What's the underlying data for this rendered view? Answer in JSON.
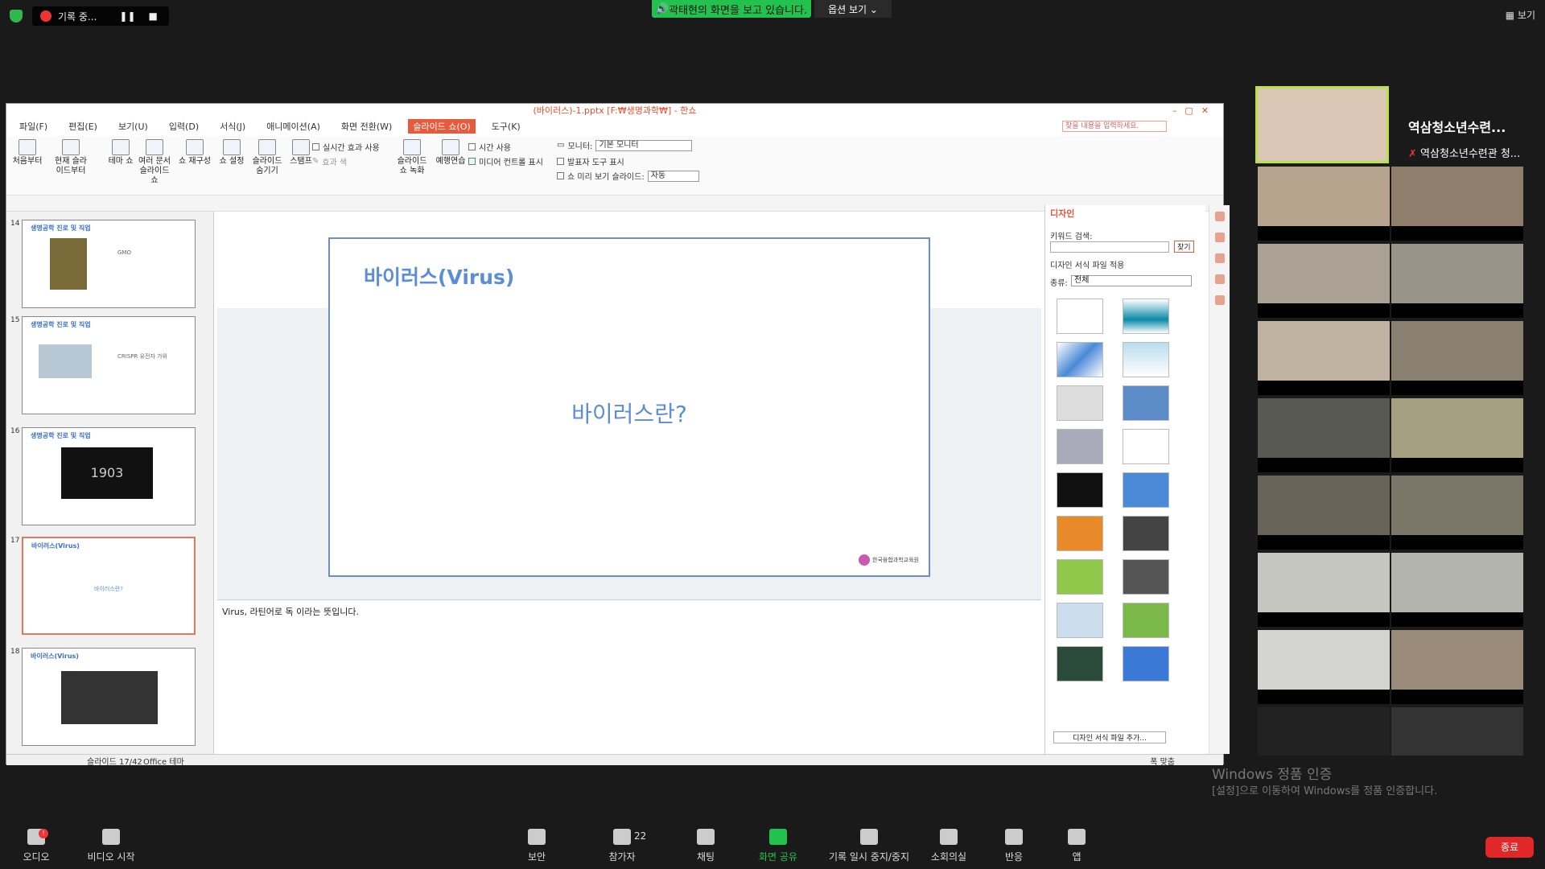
{
  "zoom_top": {
    "recording_label": "기록 중...",
    "viewing_banner": "곽태현의 화면을 보고 있습니다.",
    "view_options": "옵션 보기 ⌄",
    "view_mode": "보기"
  },
  "window": {
    "title": "(바이러스)-1.pptx [F:₩생명과학₩] - 한쇼",
    "menus": [
      "파일(F)",
      "편집(E)",
      "보기(U)",
      "입력(D)",
      "서식(J)",
      "애니메이션(A)",
      "화면 전환(W)",
      "슬라이드 쇼(O)",
      "도구(K)"
    ],
    "menu_search_placeholder": "찾을 내용을 입력하세요.",
    "ribbon": {
      "buttons": [
        "처음부터",
        "현재 슬라이드부터",
        "테마 쇼",
        "여러 문서 슬라이드 쇼",
        "쇼 재구성",
        "쇼 설정",
        "슬라이드 숨기기",
        "스탬프",
        "슬라이드 쇼 녹화",
        "예행연습"
      ],
      "opt_realtime_effect": "실시간 효과 사용",
      "opt_effect_color": "효과 색",
      "opt_use_timing": "시간 사용",
      "opt_media_controls": "미디어 컨트롤 표시",
      "monitor_label": "모니터:",
      "monitor_value": "기본 모니터",
      "opt_presenter_tools": "발표자 도구 표시",
      "preview_label": "쇼 미리 보기 슬라이드:",
      "preview_value": "자동"
    }
  },
  "slides": [
    {
      "num": "14",
      "header": "생명공학 진로 및 직업",
      "body": "GMO"
    },
    {
      "num": "15",
      "header": "생명공학 진로 및 직업",
      "body": "CRISPR 유전자 가위"
    },
    {
      "num": "16",
      "header": "생명공학 진로 및 직업",
      "body": "1903"
    },
    {
      "num": "17",
      "header": "바이러스(Virus)",
      "body": "바이러스란?"
    },
    {
      "num": "18",
      "header": "바이러스(Virus)",
      "body": ""
    }
  ],
  "current_slide": {
    "title": "바이러스(Virus)",
    "body": "바이러스란?",
    "logo_text": "한국융합과학교육원"
  },
  "notes": "Virus, 라틴어로 독 이라는 뜻입니다.",
  "design_pane": {
    "title": "디자인",
    "keyword_label": "키워드 검색:",
    "find_button": "찾기",
    "apply_file_label": "디자인 서식 파일 적용",
    "type_label": "종류:",
    "type_value": "전체",
    "add_button": "디자인 서식 파일 추가..."
  },
  "status": {
    "slide_info": "슬라이드 17/42",
    "theme": "Office 테마",
    "zoom": "폭 맞춤"
  },
  "participants": {
    "host_name": "역삼청소년수련...",
    "host_sub": "역삼청소년수련관 청..."
  },
  "windows_watermark": {
    "line1": "Windows 정품 인증",
    "line2": "[설정]으로 이동하여 Windows를 정품 인증합니다."
  },
  "bottom_toolbar": {
    "audio": "오디오",
    "video": "비디오 시작",
    "security": "보안",
    "participants": "참가자",
    "participants_count": "22",
    "chat": "채팅",
    "share": "화면 공유",
    "record": "기록 일시 중지/중지",
    "breakout": "소회의실",
    "reactions": "반응",
    "apps": "앱",
    "end": "종료"
  }
}
